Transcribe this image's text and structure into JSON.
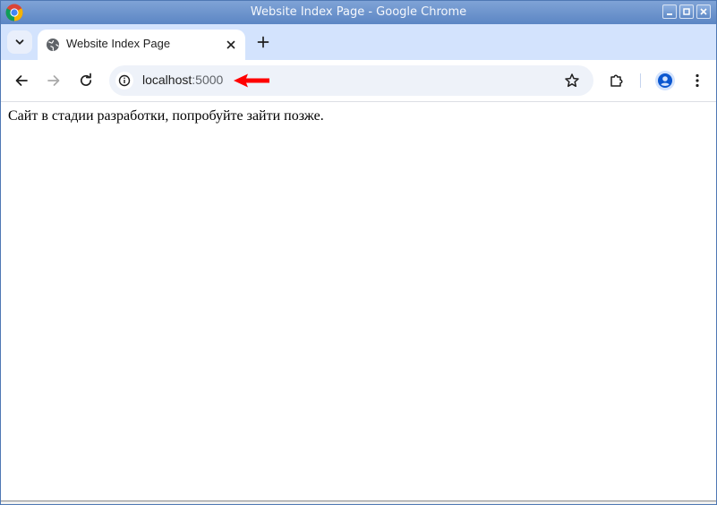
{
  "window": {
    "title": "Website Index Page - Google Chrome"
  },
  "tabs": [
    {
      "title": "Website Index Page",
      "favicon": "globe-icon",
      "active": true
    }
  ],
  "omnibox": {
    "host": "localhost",
    "port": ":5000"
  },
  "page": {
    "message": "Сайт в стадии разработки, попробуйте зайти позже."
  },
  "colors": {
    "titlebar": "#6a92cc",
    "tabstrip": "#d3e3fd",
    "omnibox": "#eef2f9",
    "annotation_arrow": "#ff0000",
    "profile_accent": "#0b57d0"
  }
}
